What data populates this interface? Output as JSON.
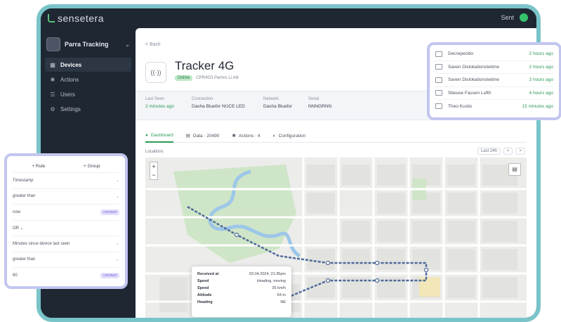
{
  "brand": {
    "name": "sensetera"
  },
  "topbar": {
    "user_label": "Sent"
  },
  "sidebar": {
    "org": "Parra Tracking",
    "items": [
      {
        "label": "Devices",
        "icon": "grid-icon",
        "active": true
      },
      {
        "label": "Actions",
        "icon": "bolt-icon",
        "active": false
      },
      {
        "label": "Users",
        "icon": "users-icon",
        "active": false
      },
      {
        "label": "Settings",
        "icon": "gear-icon",
        "active": false
      }
    ]
  },
  "device": {
    "back": "< Back",
    "icon_text": "((·))",
    "title": "Tracker 4G",
    "status": "Online",
    "subtitle": "CPR4G3 Parmis Li.mit"
  },
  "meta": [
    {
      "label": "Last Seen",
      "value": "2 minutes ago",
      "green": true
    },
    {
      "label": "Connection",
      "value": "Dasha Bluefor NUCE LED",
      "green": false
    },
    {
      "label": "Network",
      "value": "Dasha Bluefor",
      "green": false
    },
    {
      "label": "Serial",
      "value": "NNNGRNN",
      "green": false
    }
  ],
  "tabs": [
    {
      "label": "Dashboard",
      "icon": "●",
      "active": true
    },
    {
      "label": "Data · 20490",
      "icon": "▤",
      "active": false
    },
    {
      "label": "Actions · 4",
      "icon": "✱",
      "active": false
    },
    {
      "label": "Configuration",
      "icon": "◐",
      "active": false
    }
  ],
  "map": {
    "section_label": "Locations",
    "controls": [
      "Last 24h",
      "<",
      ">"
    ],
    "popup": [
      {
        "k": "Received at",
        "v": "03.04.2024, 21:35pm"
      },
      {
        "k": "Speed",
        "v": "Heading, moving"
      },
      {
        "k": "Speed",
        "v": "35 km/h"
      },
      {
        "k": "Altitude",
        "v": "64 m"
      },
      {
        "k": "Heading",
        "v": "NE"
      }
    ],
    "colors": {
      "park": "#cfe5c7",
      "water": "#9cc7e8",
      "route": "#4d6a9a",
      "road": "#ffffff",
      "block": "#e7e7e4"
    }
  },
  "events": [
    {
      "name": "Decrepecitio",
      "time": "2 hours ago"
    },
    {
      "name": "Saven Dislokationstetime",
      "time": "2 hours ago"
    },
    {
      "name": "Saven Dislokationstetime",
      "time": "3 hours ago"
    },
    {
      "name": "Sbeuse Fassen Lufth",
      "time": "4 hours ago"
    },
    {
      "name": "Theo Kustis",
      "time": "15 minutes ago"
    }
  ],
  "rules": {
    "head": [
      "+ Rule",
      "+ Group"
    ],
    "rows": [
      {
        "label": "Timestamp",
        "tag": "",
        "chev": "⌄"
      },
      {
        "label": "greater than",
        "tag": "",
        "chev": "⌄"
      },
      {
        "label": "now",
        "tag": "constant",
        "chev": ""
      },
      {
        "label": "OR   ⌄",
        "tag": "",
        "chev": ""
      },
      {
        "label": "Minutes since device last seen",
        "tag": "",
        "chev": "⌄"
      },
      {
        "label": "greater than",
        "tag": "",
        "chev": "⌄"
      },
      {
        "label": "60",
        "tag": "constant",
        "chev": ""
      }
    ]
  }
}
